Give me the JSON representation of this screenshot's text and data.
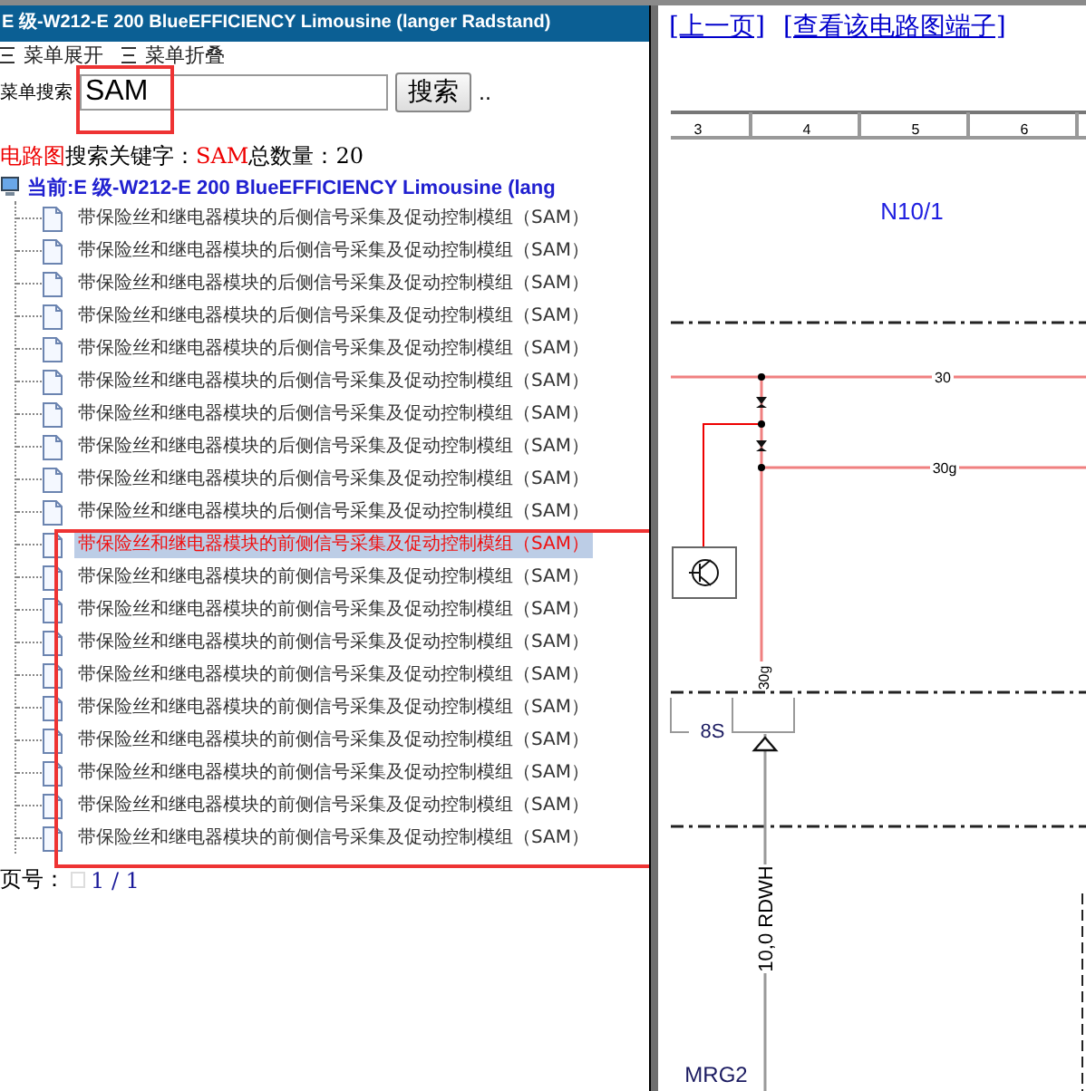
{
  "left_pane": {
    "title": "E 级-W212-E 200 BlueEFFICIENCY Limousine (langer Radstand)",
    "menu_actions": [
      {
        "label": "菜单展开"
      },
      {
        "label": "菜单折叠"
      }
    ],
    "search": {
      "label": "菜单搜索",
      "value": "SAM",
      "button": "搜索",
      "trailing": ".."
    },
    "summary": {
      "category": "电路图",
      "keyword_label": "搜索关键字：",
      "keyword": "SAM",
      "count_label": "总数量：",
      "count": "20"
    },
    "tree": [
      {
        "label": "当前:E 级-W212-E 200 BlueEFFICIENCY Limousine (lang",
        "children": [
          {
            "label": "带保险丝和继电器模块的后侧信号采集及促动控制模组（SAM）",
            "selected": false
          },
          {
            "label": "带保险丝和继电器模块的后侧信号采集及促动控制模组（SAM）",
            "selected": false
          },
          {
            "label": "带保险丝和继电器模块的后侧信号采集及促动控制模组（SAM）",
            "selected": false
          },
          {
            "label": "带保险丝和继电器模块的后侧信号采集及促动控制模组（SAM）",
            "selected": false
          },
          {
            "label": "带保险丝和继电器模块的后侧信号采集及促动控制模组（SAM）",
            "selected": false
          },
          {
            "label": "带保险丝和继电器模块的后侧信号采集及促动控制模组（SAM）",
            "selected": false
          },
          {
            "label": "带保险丝和继电器模块的后侧信号采集及促动控制模组（SAM）",
            "selected": false
          },
          {
            "label": "带保险丝和继电器模块的后侧信号采集及促动控制模组（SAM）",
            "selected": false
          },
          {
            "label": "带保险丝和继电器模块的后侧信号采集及促动控制模组（SAM）",
            "selected": false
          },
          {
            "label": "带保险丝和继电器模块的后侧信号采集及促动控制模组（SAM）",
            "selected": false
          },
          {
            "label": "带保险丝和继电器模块的前侧信号采集及促动控制模组（SAM）",
            "selected": true
          },
          {
            "label": "带保险丝和继电器模块的前侧信号采集及促动控制模组（SAM）",
            "selected": false
          },
          {
            "label": "带保险丝和继电器模块的前侧信号采集及促动控制模组（SAM）",
            "selected": false
          },
          {
            "label": "带保险丝和继电器模块的前侧信号采集及促动控制模组（SAM）",
            "selected": false
          },
          {
            "label": "带保险丝和继电器模块的前侧信号采集及促动控制模组（SAM）",
            "selected": false
          },
          {
            "label": "带保险丝和继电器模块的前侧信号采集及促动控制模组（SAM）",
            "selected": false
          },
          {
            "label": "带保险丝和继电器模块的前侧信号采集及促动控制模组（SAM）",
            "selected": false
          },
          {
            "label": "带保险丝和继电器模块的前侧信号采集及促动控制模组（SAM）",
            "selected": false
          },
          {
            "label": "带保险丝和继电器模块的前侧信号采集及促动控制模组（SAM）",
            "selected": false
          },
          {
            "label": "带保险丝和继电器模块的前侧信号采集及促动控制模组（SAM）",
            "selected": false
          }
        ]
      }
    ],
    "pager": {
      "label": "页号：",
      "value": "1 / 1"
    }
  },
  "right_pane": {
    "links": [
      {
        "label": "[上一页]"
      },
      {
        "label": "[查看该电路图端子]"
      }
    ],
    "diagram": {
      "columns": [
        "3",
        "4",
        "5",
        "6"
      ],
      "component": "N10/1",
      "wire_labels": [
        "30",
        "30g"
      ],
      "pin_label": "30g",
      "connector": "8S",
      "wire_code": "10,0 RDWH",
      "ground": "MRG2"
    }
  }
}
